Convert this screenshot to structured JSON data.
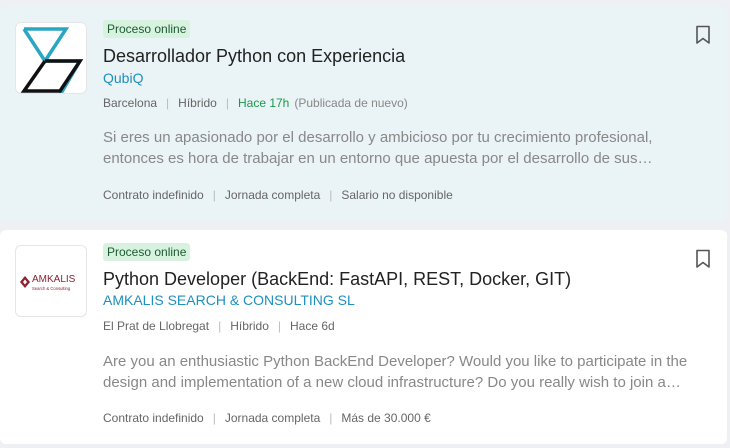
{
  "offers": [
    {
      "badge": "Proceso online",
      "title": "Desarrollador Python con Experiencia",
      "company": "QubiQ",
      "location": "Barcelona",
      "modality": "Híbrido",
      "posted": "Hace 17h",
      "republished": "(Publicada de nuevo)",
      "description": "Si eres un apasionado por el desarrollo y ambicioso por tu crecimiento profesional, entonces es hora de trabajar en un entorno que apuesta por el desarrollo de sus profesionales y te ofrece la oportunidad de crecer con nosotros.",
      "contract": "Contrato indefinido",
      "schedule": "Jornada completa",
      "salary": "Salario no disponible",
      "logo_icon": "qubiq-logo",
      "bookmark_icon": "bookmark-icon"
    },
    {
      "badge": "Proceso online",
      "title": "Python Developer (BackEnd: FastAPI, REST, Docker, GIT)",
      "company": "AMKALIS SEARCH & CONSULTING SL",
      "location": "El Prat de Llobregat",
      "modality": "Híbrido",
      "posted": "Hace 6d",
      "description": "Are you an enthusiastic Python BackEnd Developer? Would you like to participate in the design and implementation of a new cloud infrastructure? Do you really wish to join a growing team?",
      "contract": "Contrato indefinido",
      "schedule": "Jornada completa",
      "salary": "Más de 30.000 €",
      "logo": {
        "name": "AMKALIS",
        "tagline": "Search & Consulting"
      },
      "bookmark_icon": "bookmark-icon"
    }
  ],
  "colors": {
    "page_bg": "#eef0f3",
    "highlight_card_bg": "#eaf3f6",
    "badge_bg": "#d7f2df",
    "company_link": "#1f8fbd",
    "recent_green": "#199a4a",
    "amkalis_brand": "#8b2233"
  }
}
